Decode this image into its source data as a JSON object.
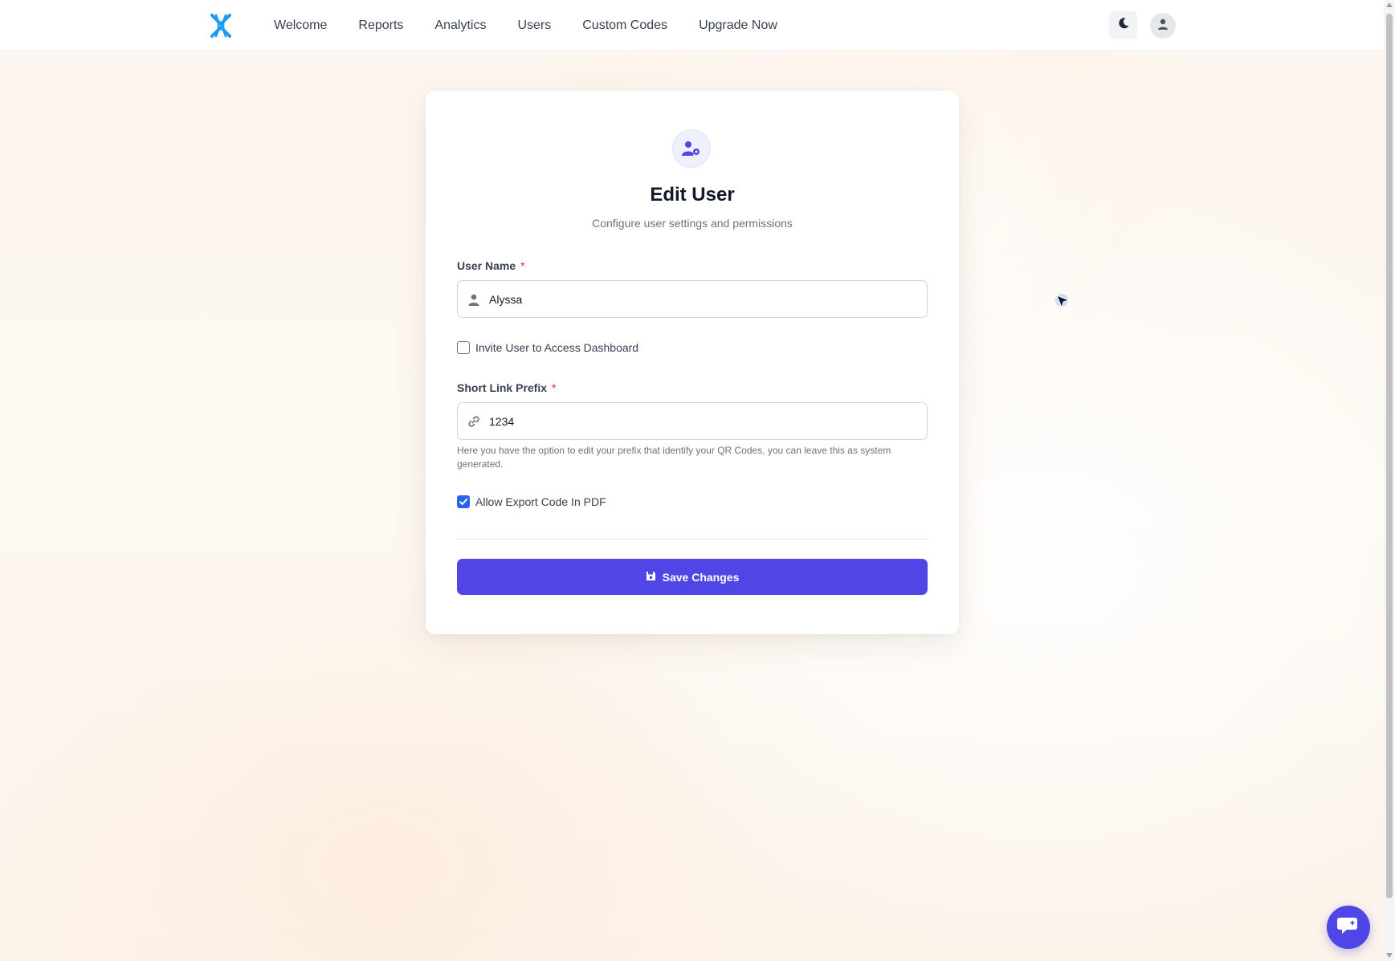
{
  "nav": {
    "logo_icon": "x-logo-icon",
    "links": [
      "Welcome",
      "Reports",
      "Analytics",
      "Users",
      "Custom Codes",
      "Upgrade Now"
    ],
    "theme_icon": "moon-icon",
    "avatar_icon": "user-icon"
  },
  "form": {
    "header_icon": "user-gear-icon",
    "title": "Edit User",
    "subtitle": "Configure user settings and permissions",
    "user_name": {
      "label": "User Name",
      "required_mark": "*",
      "value": "Alyssa",
      "icon": "user-icon"
    },
    "invite": {
      "label": "Invite User to Access Dashboard",
      "checked": false
    },
    "short_link_prefix": {
      "label": "Short Link Prefix",
      "required_mark": "*",
      "value": "1234",
      "icon": "link-icon",
      "help": "Here you have the option to edit your prefix that identify your QR Codes, you can leave this as system generated."
    },
    "allow_export": {
      "label": "Allow Export Code In PDF",
      "checked": true
    },
    "save_label": "Save Changes",
    "save_icon": "save-icon"
  },
  "chat_icon": "chat-icon",
  "colors": {
    "primary": "#4f46e5",
    "checkbox_checked": "#2563eb",
    "logo": "#1d9bf0",
    "required": "#dc2626"
  }
}
